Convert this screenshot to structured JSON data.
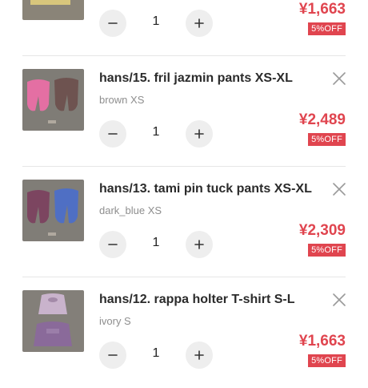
{
  "items": [
    {
      "name": "",
      "option": "",
      "quantity": "1",
      "price": "¥1,663",
      "discount": "5%OFF",
      "thumb_icon": "yellow-garment-photo"
    },
    {
      "name": "hans/15. fril jazmin pants XS-XL",
      "option": "brown XS",
      "quantity": "1",
      "price": "¥2,489",
      "discount": "5%OFF",
      "thumb_icon": "pink-and-brown-pants-photo"
    },
    {
      "name": "hans/13. tami pin tuck pants XS-XL",
      "option": "dark_blue XS",
      "quantity": "1",
      "price": "¥2,309",
      "discount": "5%OFF",
      "thumb_icon": "plum-and-blue-pants-photo"
    },
    {
      "name": "hans/12. rappa holter T-shirt S-L",
      "option": "ivory S",
      "quantity": "1",
      "price": "¥1,663",
      "discount": "5%OFF",
      "thumb_icon": "lilac-tops-photo"
    }
  ],
  "colors": {
    "price": "#e0454f",
    "badge_bg": "#e0454f",
    "qty_button_bg": "#eeeeee",
    "option_text": "#8e8e8e"
  },
  "icons": {
    "minus": "minus-icon",
    "plus": "plus-icon",
    "remove": "close-icon"
  }
}
